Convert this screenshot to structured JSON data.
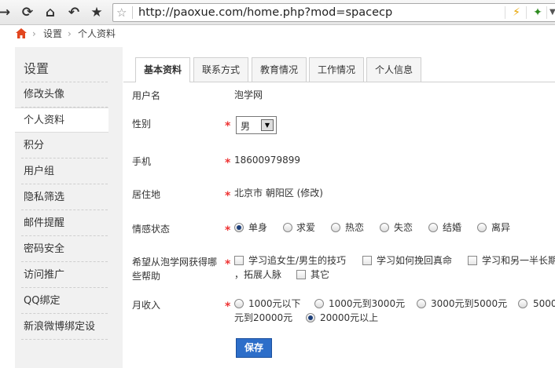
{
  "browser": {
    "url": "http://paoxue.com/home.php?mod=spacecp"
  },
  "breadcrumb": {
    "items": [
      "设置",
      "个人资料"
    ]
  },
  "sidebar": {
    "title": "设置",
    "items": [
      "修改头像",
      "个人资料",
      "积分",
      "用户组",
      "隐私筛选",
      "邮件提醒",
      "密码安全",
      "访问推广",
      "QQ绑定",
      "新浪微博绑定设"
    ],
    "active": "个人资料"
  },
  "tabs": [
    "基本资料",
    "联系方式",
    "教育情况",
    "工作情况",
    "个人信息"
  ],
  "form": {
    "username": {
      "label": "用户名",
      "value": "泡学网"
    },
    "gender": {
      "label": "性别",
      "value": "男"
    },
    "phone": {
      "label": "手机",
      "value": "18600979899"
    },
    "residence": {
      "label": "居住地",
      "value": "北京市 朝阳区 (修改)"
    },
    "relationship": {
      "label": "情感状态",
      "options": [
        "单身",
        "求爱",
        "热恋",
        "失恋",
        "结婚",
        "离异"
      ],
      "selected": "单身"
    },
    "wants": {
      "label_line1": "希望从泡学网获得哪",
      "label_line2": "些帮助",
      "options": [
        "学习追女生/男生的技巧",
        "学习如何挽回真命",
        "学习和另一半长期",
        "，拓展人脉",
        "其它"
      ]
    },
    "income": {
      "label": "月收入",
      "options": [
        "1000元以下",
        "1000元到3000元",
        "3000元到5000元",
        "5000",
        "元到20000元",
        "20000元以上"
      ],
      "selected": "20000元以上"
    },
    "save_label": "保存"
  },
  "colors": {
    "required": "#ee3333",
    "save_button": "#2d6ec9",
    "sidebar_bg": "#f1f1f1"
  }
}
